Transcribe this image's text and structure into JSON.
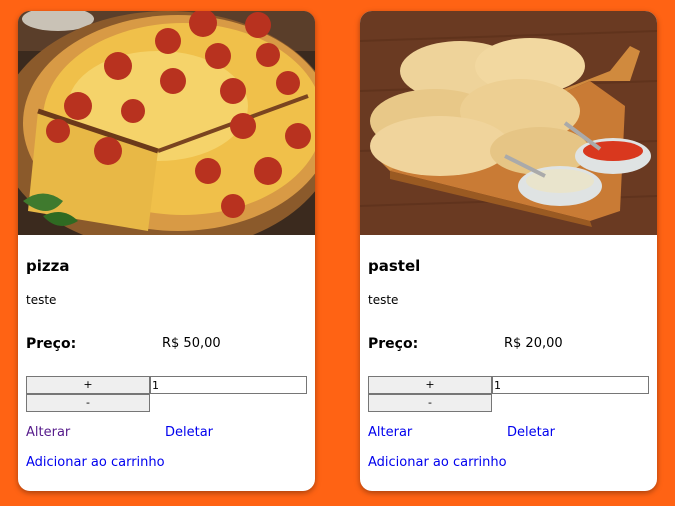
{
  "colors": {
    "page_background": "#ff6314",
    "card_background": "#ffffff",
    "visited_link": "#551a8b",
    "link": "#0000ee"
  },
  "products": [
    {
      "image_icon": "pizza-photo",
      "name": "pizza",
      "description": "teste",
      "price_label": "Preço:",
      "price": "R$ 50,00",
      "plus_label": "+",
      "minus_label": "-",
      "quantity": "1",
      "edit_label": "Alterar",
      "delete_label": "Deletar",
      "add_to_cart_label": "Adicionar ao carrinho"
    },
    {
      "image_icon": "pastel-photo",
      "name": "pastel",
      "description": "teste",
      "price_label": "Preço:",
      "price": "R$ 20,00",
      "plus_label": "+",
      "minus_label": "-",
      "quantity": "1",
      "edit_label": "Alterar",
      "delete_label": "Deletar",
      "add_to_cart_label": "Adicionar ao carrinho"
    }
  ]
}
